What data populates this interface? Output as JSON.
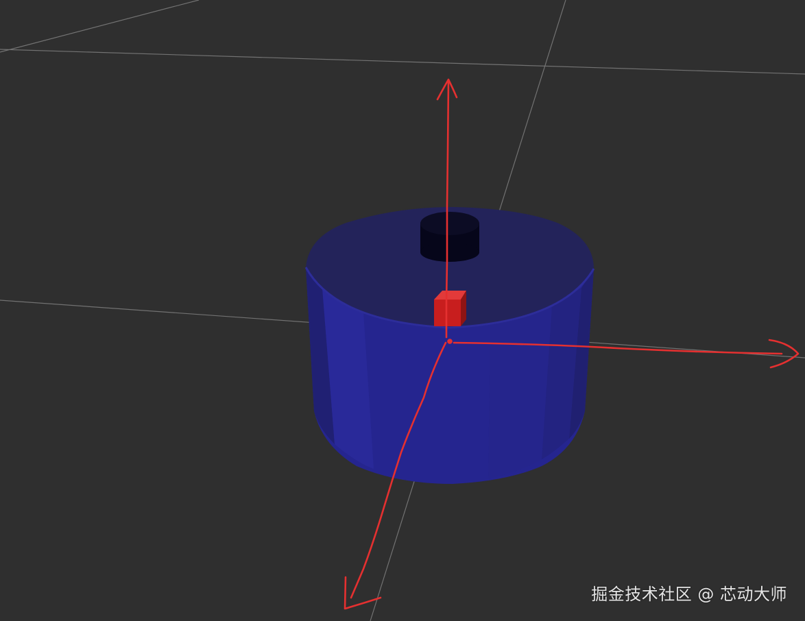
{
  "viewport": {
    "background": "#2f2f2f",
    "grid_color": "#8a8a8a",
    "cylinder_top_color": "#242459",
    "cylinder_side_color": "#252590",
    "hole_color": "#050512",
    "marker_color": "#c81e1e",
    "annotation_color": "#e53030"
  },
  "watermark": {
    "text": "掘金技术社区 @ 芯动大师"
  }
}
